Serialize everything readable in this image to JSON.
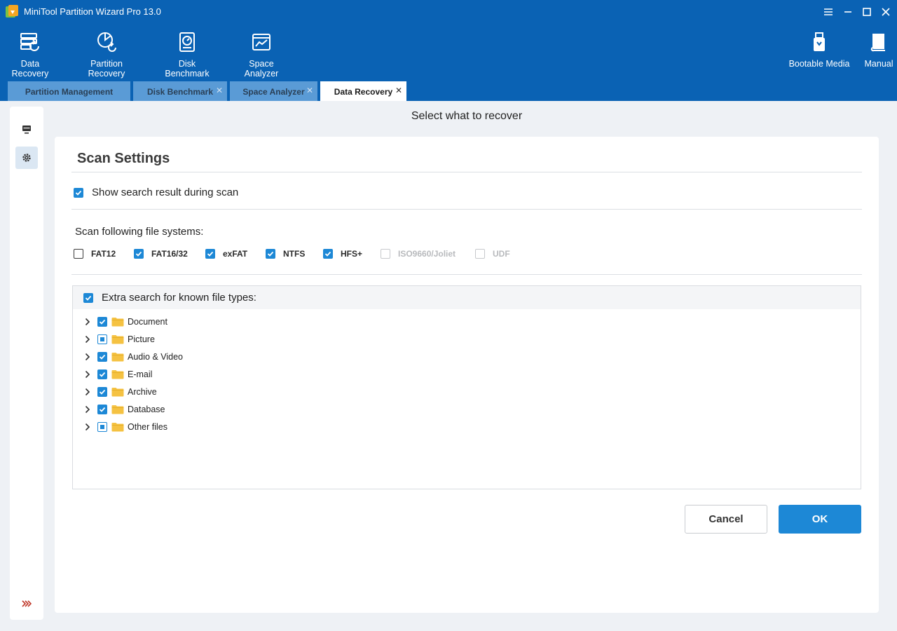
{
  "window": {
    "title": "MiniTool Partition Wizard Pro 13.0"
  },
  "toolbar": {
    "data_recovery": "Data Recovery",
    "partition_recovery": "Partition Recovery",
    "disk_benchmark": "Disk Benchmark",
    "space_analyzer": "Space Analyzer",
    "bootable_media": "Bootable Media",
    "manual": "Manual"
  },
  "tabs": [
    {
      "label": "Partition Management",
      "active": false
    },
    {
      "label": "Disk Benchmark",
      "active": false
    },
    {
      "label": "Space Analyzer",
      "active": false
    },
    {
      "label": "Data Recovery",
      "active": true
    }
  ],
  "page": {
    "heading": "Select what to recover"
  },
  "scan_settings": {
    "title": "Scan Settings",
    "show_result_label": "Show search result during scan",
    "show_result_checked": true,
    "fs_label": "Scan following file systems:",
    "file_systems": [
      {
        "label": "FAT12",
        "state": "unchecked"
      },
      {
        "label": "FAT16/32",
        "state": "checked"
      },
      {
        "label": "exFAT",
        "state": "checked"
      },
      {
        "label": "NTFS",
        "state": "checked"
      },
      {
        "label": "HFS+",
        "state": "checked"
      },
      {
        "label": "ISO9660/Joliet",
        "state": "disabled"
      },
      {
        "label": "UDF",
        "state": "disabled"
      }
    ],
    "extra_label": "Extra search for known file types:",
    "extra_checked": true,
    "file_types": [
      {
        "label": "Document",
        "state": "checked"
      },
      {
        "label": "Picture",
        "state": "partial"
      },
      {
        "label": "Audio & Video",
        "state": "checked"
      },
      {
        "label": "E-mail",
        "state": "checked"
      },
      {
        "label": "Archive",
        "state": "checked"
      },
      {
        "label": "Database",
        "state": "checked"
      },
      {
        "label": "Other files",
        "state": "partial"
      }
    ]
  },
  "buttons": {
    "cancel": "Cancel",
    "ok": "OK"
  },
  "colors": {
    "titlebar": "#0a62b4",
    "accent": "#1d88d6",
    "folder": "#f5c242"
  }
}
